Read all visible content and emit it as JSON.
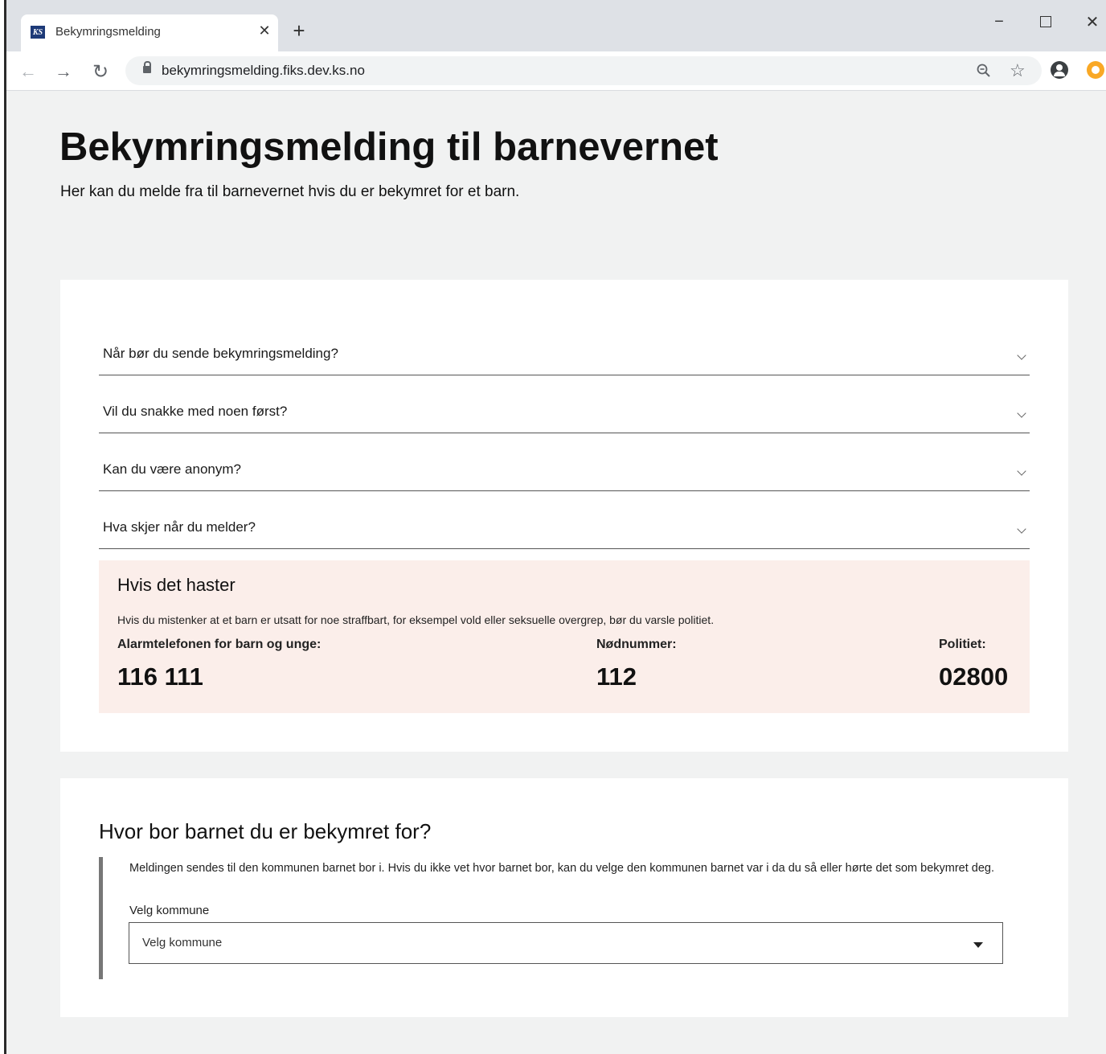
{
  "browser": {
    "tab_title": "Bekymringsmelding",
    "favicon_text": "KS",
    "url": "bekymringsmelding.fiks.dev.ks.no"
  },
  "header": {
    "title": "Bekymringsmelding til barnevernet",
    "subtitle": "Her kan du melde fra til barnevernet hvis du er bekymret for et barn."
  },
  "accordion": [
    {
      "label": "Når bør du sende bekymringsmelding?"
    },
    {
      "label": "Vil du snakke med noen først?"
    },
    {
      "label": "Kan du være anonym?"
    },
    {
      "label": "Hva skjer når du melder?"
    }
  ],
  "urgent": {
    "title": "Hvis det haster",
    "text": "Hvis du mistenker at et barn er utsatt for noe straffbart, for eksempel vold eller seksuelle overgrep, bør du varsle politiet.",
    "contacts": [
      {
        "label": "Alarmtelefonen for barn og unge:",
        "number": "116 111"
      },
      {
        "label": "Nødnummer:",
        "number": "112"
      },
      {
        "label": "Politiet:",
        "number": "02800"
      }
    ]
  },
  "location": {
    "heading": "Hvor bor barnet du er bekymret for?",
    "info": "Meldingen sendes til den kommunen barnet bor i. Hvis du ikke vet hvor barnet bor, kan du velge den kommunen barnet var i da du så eller hørte det som bekymret deg.",
    "field_label": "Velg kommune",
    "select_value": "Velg kommune"
  },
  "colors": {
    "page_bg": "#f1f2f2",
    "urgent_bg": "#fbeeea",
    "tabstrip_bg": "#dee1e6"
  }
}
